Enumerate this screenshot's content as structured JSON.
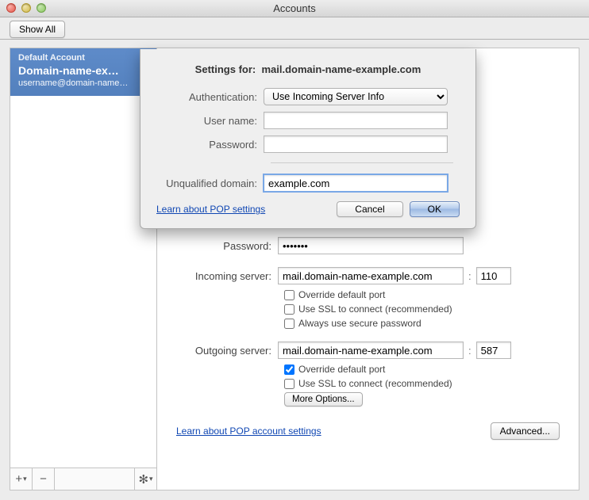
{
  "window": {
    "title": "Accounts"
  },
  "toolbar": {
    "show_all": "Show All"
  },
  "sidebar": {
    "default_label": "Default Account",
    "account_name": "Domain-name-ex…",
    "account_email": "username@domain-name…",
    "add": "+",
    "remove": "−",
    "gear": "✻"
  },
  "main": {
    "password_label": "Password:",
    "password_value": "•••••••",
    "incoming_label": "Incoming server:",
    "incoming_value": "mail.domain-name-example.com",
    "incoming_port": "110",
    "override_port": "Override default port",
    "use_ssl": "Use SSL to connect (recommended)",
    "secure_pw": "Always use secure password",
    "outgoing_label": "Outgoing server:",
    "outgoing_value": "mail.domain-name-example.com",
    "outgoing_port": "587",
    "more_options": "More Options...",
    "learn_link": "Learn about POP account settings",
    "advanced": "Advanced..."
  },
  "sheet": {
    "settings_for_label": "Settings for:",
    "settings_for_value": "mail.domain-name-example.com",
    "auth_label": "Authentication:",
    "auth_value": "Use Incoming Server Info",
    "username_label": "User name:",
    "username_value": "",
    "password_label": "Password:",
    "password_value": "",
    "domain_label": "Unqualified domain:",
    "domain_value": "example.com",
    "learn_link": "Learn about POP settings",
    "cancel": "Cancel",
    "ok": "OK"
  }
}
